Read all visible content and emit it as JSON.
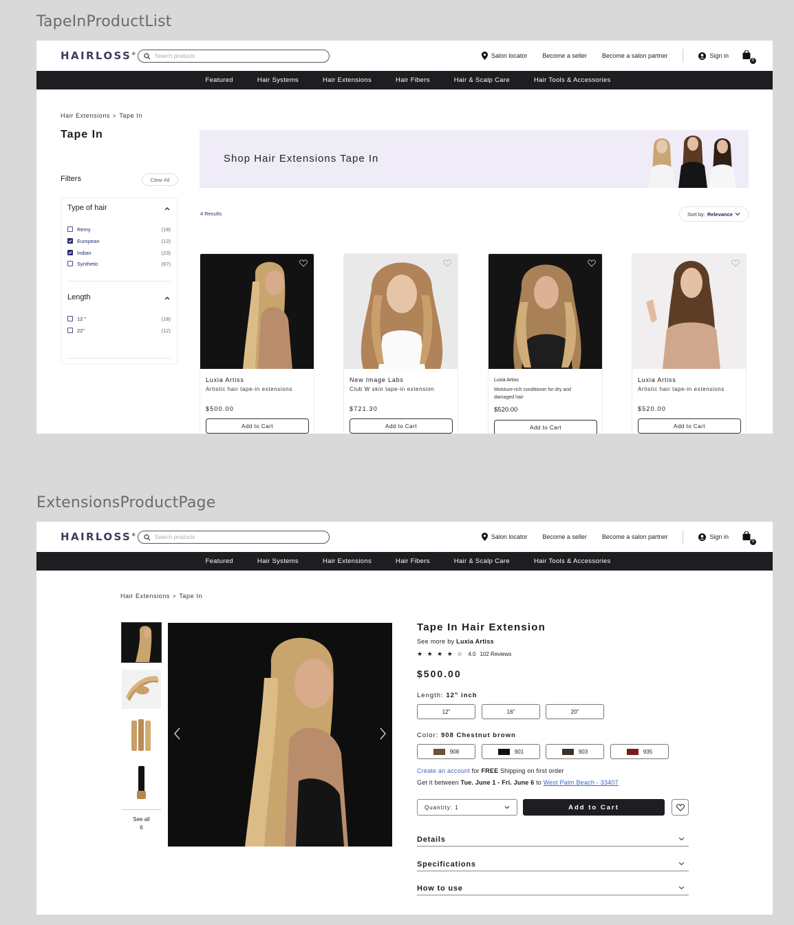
{
  "frames": {
    "list_label": "TapeInProductList",
    "product_label": "ExtensionsProductPage"
  },
  "header": {
    "logo": "HAIRLOSS",
    "logo_mark": "®",
    "search_placeholder": "Search products",
    "salon_locator": "Salon locator",
    "become_seller": "Become a seller",
    "become_partner": "Become a salon partner",
    "sign_in": "Sign in",
    "cart_count": "0"
  },
  "nav": [
    "Featured",
    "Hair Systems",
    "Hair Extensions",
    "Hair Fibers",
    "Hair & Scalp Care",
    "Hair Tools & Accessories"
  ],
  "breadcrumb": {
    "parent": "Hair Extensions",
    "separator": ">",
    "current": "Tape In"
  },
  "list": {
    "title": "Tape In",
    "filters_label": "Filters",
    "clear_all": "Clear All",
    "type_of_hair": {
      "title": "Type of hair",
      "options": [
        {
          "label": "Remy",
          "count": "(18)",
          "checked": false
        },
        {
          "label": "European",
          "count": "(12)",
          "checked": true
        },
        {
          "label": "Indian",
          "count": "(23)",
          "checked": true
        },
        {
          "label": "Synthetic",
          "count": "(67)",
          "checked": false
        }
      ]
    },
    "length": {
      "title": "Length",
      "options": [
        {
          "label": "12 \"",
          "count": "(18)",
          "checked": false
        },
        {
          "label": "22\"",
          "count": "(12)",
          "checked": false
        }
      ]
    },
    "banner_text": "Shop Hair Extensions Tape In",
    "results": "4 Results",
    "sort_prefix": "Sort by:",
    "sort_value": "Relevance",
    "products": [
      {
        "brand": "Luxia Artiss",
        "desc": "Artistic hair tape-in extensions",
        "price": "$500.00",
        "cta": "Add to Cart"
      },
      {
        "brand": "New Image Labs",
        "desc": "Club W skin tape-in extension",
        "price": "$721.30",
        "cta": "Add to Cart"
      },
      {
        "brand": "Luxia Artiss",
        "desc": "Moisture-rich conditioner for dry and damaged hair",
        "price": "$520.00",
        "cta": "Add to Cart"
      },
      {
        "brand": "Luxia Artiss",
        "desc": "Artistic hair tape-in extensions",
        "price": "$520.00",
        "cta": "Add to Cart"
      }
    ]
  },
  "product": {
    "see_all": "See all",
    "see_all_count": "6",
    "title": "Tape In Hair Extension",
    "see_more_prefix": "See more by",
    "brand": "Luxia Artiss",
    "stars": "★ ★ ★ ★ ☆",
    "rating": "4.0",
    "reviews": "102 Reviews",
    "price": "$500.00",
    "length_label": "Length:",
    "length_value": "12\" inch",
    "lengths": [
      "12\"",
      "16\"",
      "20\""
    ],
    "color_label": "Color:",
    "color_value": "908 Chestnut brown",
    "colors": [
      {
        "code": "908",
        "hex": "#6b5138"
      },
      {
        "code": "901",
        "hex": "#111111"
      },
      {
        "code": "903",
        "hex": "#3b3129"
      },
      {
        "code": "935",
        "hex": "#7a1b1b"
      }
    ],
    "ship_link": "Create an account",
    "ship_mid": "for",
    "ship_bold": "FREE",
    "ship_rest": "Shipping on first order",
    "get_prefix": "Get it between",
    "get_dates": "Tue. June 1 - Fri. June 6",
    "get_to": "to",
    "get_location": "West Palm Beach - 33407",
    "quantity": "Quantity: 1",
    "add_to_cart": "Add to Cart",
    "accordions": [
      "Details",
      "Specifications",
      "How to use"
    ]
  }
}
